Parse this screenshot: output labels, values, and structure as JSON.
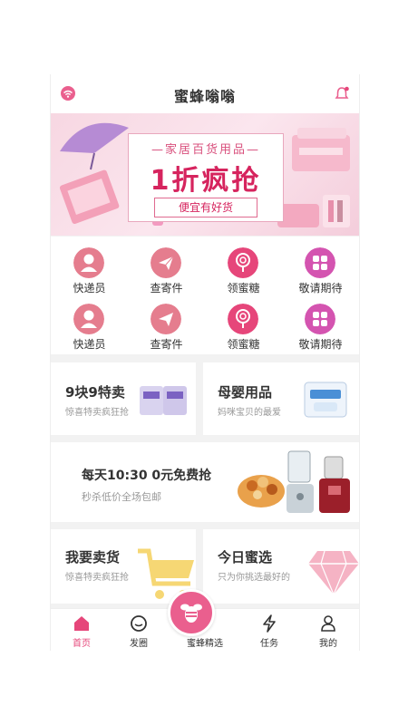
{
  "header": {
    "title": "蜜蜂嗡嗡"
  },
  "banner": {
    "subtitle": "—家居百货用品—",
    "headline": "1折疯抢",
    "tagline": "便宜有好货"
  },
  "grid": {
    "items": [
      {
        "label": "快递员",
        "icon": "courier-icon",
        "color": "#e57d8e"
      },
      {
        "label": "查寄件",
        "icon": "paper-plane-icon",
        "color": "#e57d8e"
      },
      {
        "label": "领蜜糖",
        "icon": "lollipop-icon",
        "color": "#e6467a"
      },
      {
        "label": "敬请期待",
        "icon": "grid-icon",
        "color": "#d454b0"
      },
      {
        "label": "快递员",
        "icon": "courier-icon",
        "color": "#e57d8e"
      },
      {
        "label": "查寄件",
        "icon": "paper-plane-icon",
        "color": "#e57d8e"
      },
      {
        "label": "领蜜糖",
        "icon": "lollipop-icon",
        "color": "#e6467a"
      },
      {
        "label": "敬请期待",
        "icon": "grid-icon",
        "color": "#d454b0"
      }
    ]
  },
  "cards": {
    "sale": {
      "title": "9块9特卖",
      "subtitle": "惊喜特卖疯狂抢"
    },
    "baby": {
      "title": "母婴用品",
      "subtitle": "妈咪宝贝的最爱"
    },
    "free": {
      "title": "每天10:30 0元免费抢",
      "subtitle": "秒杀低价全场包邮"
    },
    "sell": {
      "title": "我要卖货",
      "subtitle": "惊喜特卖疯狂抢"
    },
    "today": {
      "title": "今日蜜选",
      "subtitle": "只为你挑选最好的"
    }
  },
  "tabbar": {
    "items": [
      {
        "label": "首页",
        "icon": "home-icon",
        "active": true
      },
      {
        "label": "发圈",
        "icon": "chat-icon",
        "active": false
      },
      {
        "label": "蜜蜂精选",
        "icon": "bee-icon",
        "active": false
      },
      {
        "label": "任务",
        "icon": "lightning-icon",
        "active": false
      },
      {
        "label": "我的",
        "icon": "user-icon",
        "active": false
      }
    ],
    "active_color": "#e6467a"
  }
}
